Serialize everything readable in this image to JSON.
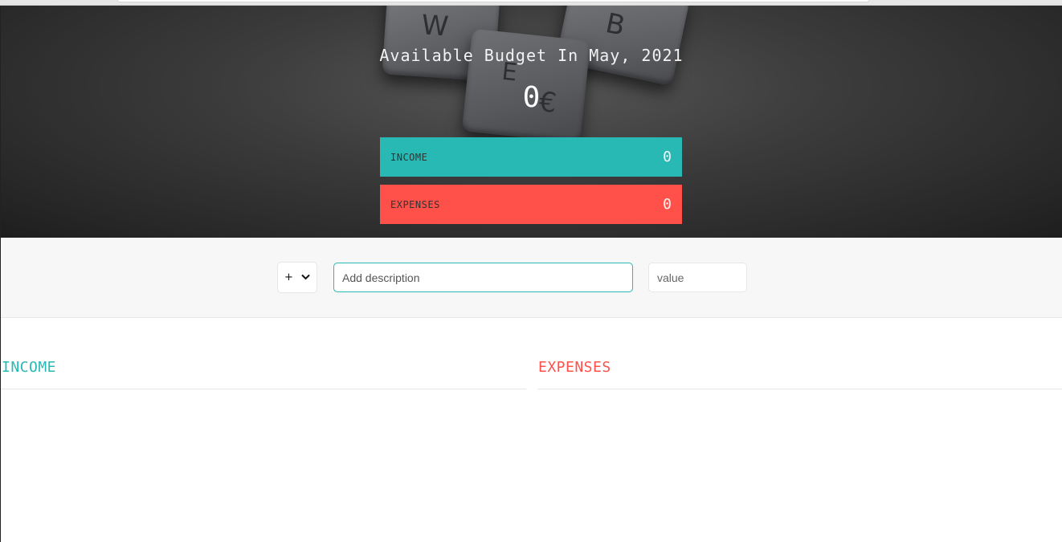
{
  "budget": {
    "title": "Available Budget In May, 2021",
    "value": "0",
    "income_label": "INCOME",
    "income_value": "0",
    "expenses_label": "EXPENSES",
    "expenses_value": "0",
    "income_color": "#28b9b5",
    "expenses_color": "#ff5049"
  },
  "hero_tiles": {
    "w": "W",
    "b": "B",
    "e": "E",
    "euro": "€"
  },
  "add": {
    "type_value": "+",
    "type_chevron": "chevron-down-icon",
    "description_placeholder": "Add description",
    "value_placeholder": "value"
  },
  "lists": {
    "income_title": "INCOME",
    "expenses_title": "EXPENSES"
  }
}
